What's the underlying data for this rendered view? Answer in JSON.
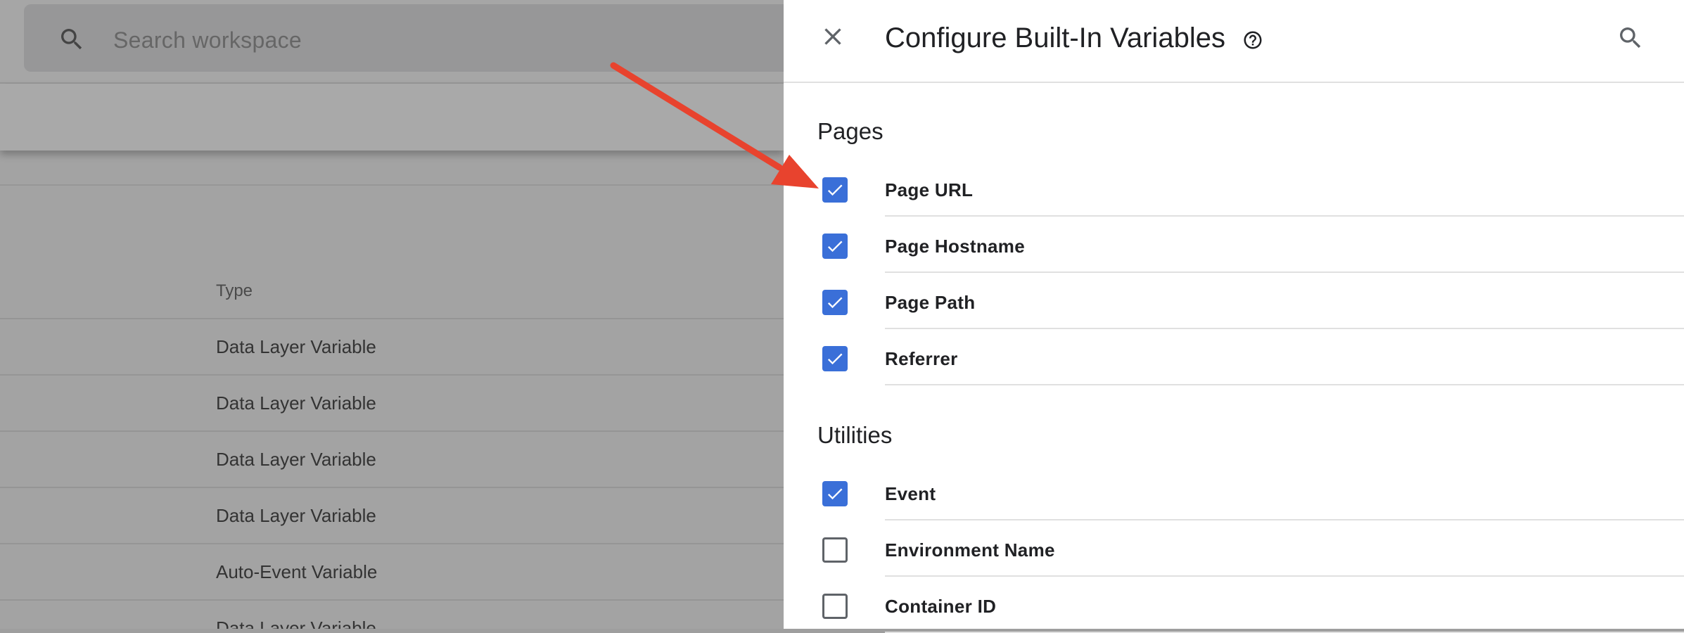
{
  "workspace": {
    "search_placeholder": "Search workspace",
    "table": {
      "column_header": "Type",
      "rows": [
        "Data Layer Variable",
        "Data Layer Variable",
        "Data Layer Variable",
        "Data Layer Variable",
        "Auto-Event Variable",
        "Data Layer Variable"
      ]
    }
  },
  "panel": {
    "title": "Configure Built-In Variables",
    "icons": {
      "close": "close-icon",
      "help": "help-circle-icon",
      "search": "search-icon"
    },
    "sections": [
      {
        "title": "Pages",
        "variables": [
          {
            "label": "Page URL",
            "checked": true
          },
          {
            "label": "Page Hostname",
            "checked": true
          },
          {
            "label": "Page Path",
            "checked": true
          },
          {
            "label": "Referrer",
            "checked": true
          }
        ]
      },
      {
        "title": "Utilities",
        "variables": [
          {
            "label": "Event",
            "checked": true
          },
          {
            "label": "Environment Name",
            "checked": false
          },
          {
            "label": "Container ID",
            "checked": false
          }
        ]
      }
    ]
  },
  "colors": {
    "checkbox_checked": "#3a6fd8",
    "annotation_arrow": "#e8432e"
  }
}
